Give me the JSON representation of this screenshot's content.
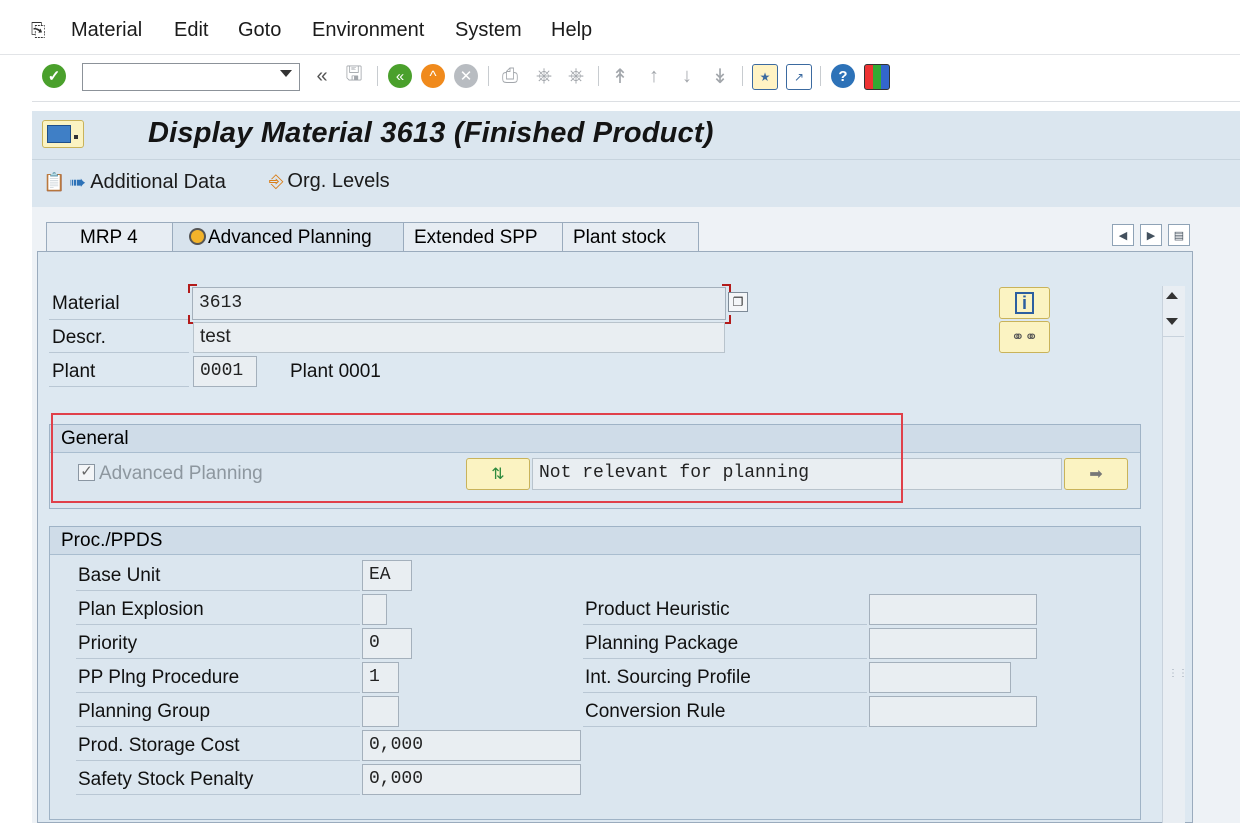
{
  "menu": {
    "items": [
      {
        "label": "Material"
      },
      {
        "label": "Edit"
      },
      {
        "label": "Goto"
      },
      {
        "label": "Environment"
      },
      {
        "label": "System"
      },
      {
        "label": "Help"
      }
    ]
  },
  "toolbar": {
    "command_value": ""
  },
  "title": {
    "text": "Display Material 3613 (Finished Product)"
  },
  "appbar": {
    "additional_data": "Additional Data",
    "org_levels": "Org. Levels"
  },
  "tabs": [
    {
      "label": "MRP 4",
      "active": false
    },
    {
      "label": "Advanced Planning",
      "active": true
    },
    {
      "label": "Extended SPP",
      "active": false
    },
    {
      "label": "Plant stock",
      "active": false
    }
  ],
  "header_fields": {
    "material_label": "Material",
    "material_value": "3613",
    "descr_label": "Descr.",
    "descr_value": "test",
    "plant_label": "Plant",
    "plant_value": "0001",
    "plant_text": "Plant 0001"
  },
  "general": {
    "title": "General",
    "advanced_planning_label": "Advanced Planning",
    "advanced_planning_checked": true,
    "status_text": "Not relevant for planning"
  },
  "proc": {
    "title": "Proc./PPDS",
    "left": [
      {
        "label": "Base Unit",
        "value": "EA"
      },
      {
        "label": "Plan Explosion",
        "value": ""
      },
      {
        "label": "Priority",
        "value": "0"
      },
      {
        "label": "PP Plng Procedure",
        "value": "1"
      },
      {
        "label": "Planning Group",
        "value": ""
      },
      {
        "label": "Prod. Storage Cost",
        "value": "0,000"
      },
      {
        "label": "Safety Stock Penalty",
        "value": "0,000"
      }
    ],
    "right": [
      {
        "label": "Product Heuristic",
        "value": ""
      },
      {
        "label": "Planning Package",
        "value": ""
      },
      {
        "label": "Int. Sourcing Profile",
        "value": ""
      },
      {
        "label": "Conversion Rule",
        "value": ""
      }
    ]
  },
  "colors": {
    "highlight": "#e0404a",
    "panel": "#dde8f1",
    "button_yellow": "#fbf3c2"
  }
}
